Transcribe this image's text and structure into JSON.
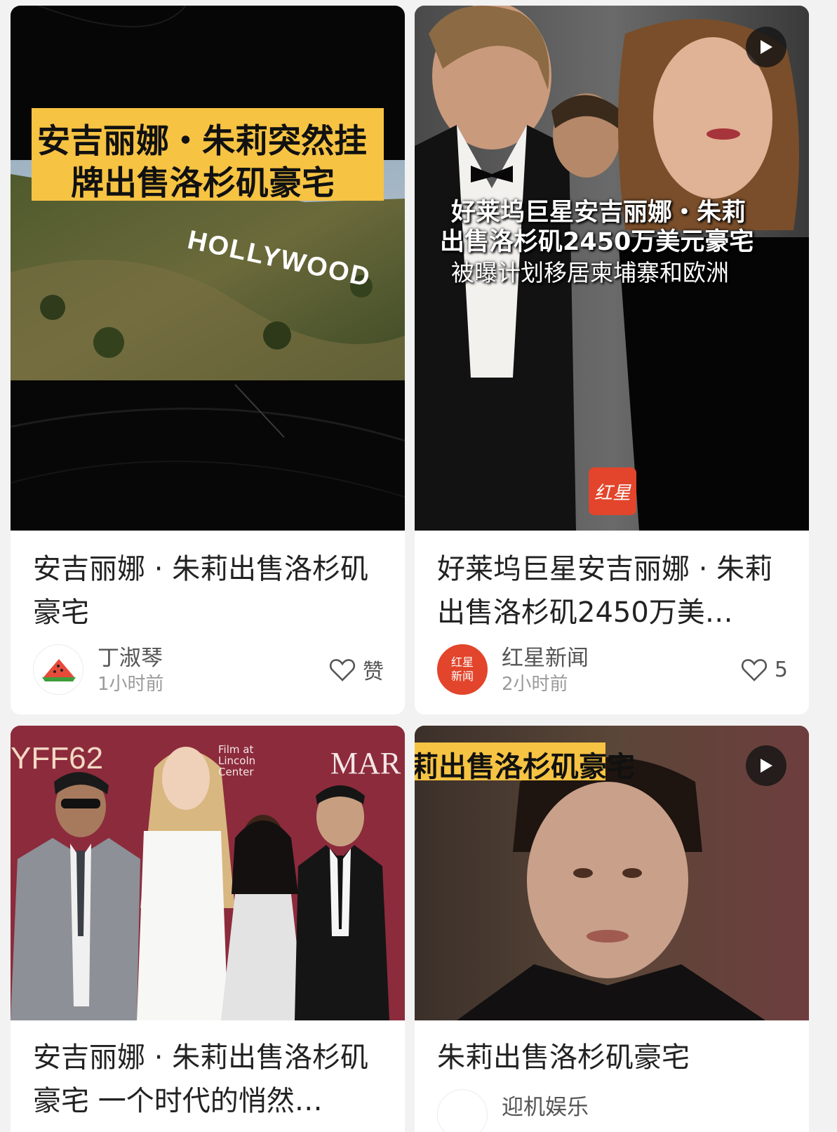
{
  "cards": [
    {
      "cover_text": [
        "安吉丽娜・朱莉突然挂",
        "牌出售洛杉矶豪宅"
      ],
      "sign_text": "HOLLYWOOD",
      "title": "安吉丽娜 · 朱莉出售洛杉矶豪宅",
      "author": "丁淑琴",
      "time": "1小时前",
      "like_label": "赞",
      "avatar_icon": "watermelon-icon"
    },
    {
      "cover_text": [
        "好莱坞巨星安吉丽娜・朱莉",
        "出售洛杉矶2450万美元豪宅",
        "被曝计划移居柬埔寨和欧洲"
      ],
      "cover_logo": "红星",
      "title": "好莱坞巨星安吉丽娜 · 朱莉出售洛杉矶2450万美…",
      "author": "红星新闻",
      "time": "2小时前",
      "like_label": "5",
      "avatar_text": "红星新闻"
    },
    {
      "backdrop_text": {
        "left": "YFF62",
        "center": "Film at Lincoln Center",
        "right": "MAR"
      },
      "title": "安吉丽娜 · 朱莉出售洛杉矶豪宅 一个时代的悄然…"
    },
    {
      "cover_text": [
        "莉出售洛杉矶豪宅"
      ],
      "title": "朱莉出售洛杉矶豪宅",
      "author": "迎机娱乐"
    }
  ],
  "colors": {
    "banner_yellow": "#f6c343",
    "brand_red": "#e2452b",
    "card_bg": "#ffffff",
    "page_bg": "#f2f2f2"
  }
}
